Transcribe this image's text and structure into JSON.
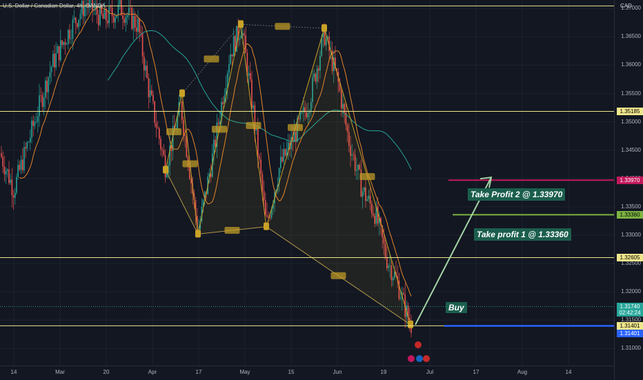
{
  "header": {
    "title": "U.S. Dollar / Canadian Dollar, 4h, OANDA"
  },
  "price_axis": {
    "currency": "CAD",
    "ticks": [
      "1.37000",
      "1.36500",
      "1.36000",
      "1.35500",
      "1.35000",
      "1.34500",
      "1.34000",
      "1.33500",
      "1.33000",
      "1.32500",
      "1.32000",
      "1.31500",
      "1.31000"
    ],
    "tick_values": [
      1.37,
      1.365,
      1.36,
      1.355,
      1.35,
      1.345,
      1.34,
      1.335,
      1.33,
      1.325,
      1.32,
      1.315,
      1.31
    ],
    "badges": [
      {
        "label": "1.35185",
        "value": 1.35185,
        "bg": "#f0e68c",
        "fg": "#000000"
      },
      {
        "label": "1.33970",
        "value": 1.3397,
        "bg": "#c2185b",
        "fg": "#ffffff"
      },
      {
        "label": "1.33360",
        "value": 1.3336,
        "bg": "#7cb342",
        "fg": "#000000"
      },
      {
        "label": "1.32605",
        "value": 1.32605,
        "bg": "#f0e68c",
        "fg": "#000000"
      },
      {
        "label": "1.31740",
        "value": 1.3174,
        "bg": "#26a69a",
        "fg": "#ffffff"
      },
      {
        "label": "02:42:24",
        "value": 1.3163,
        "bg": "#26a69a",
        "fg": "#ffffff"
      },
      {
        "label": "1.31401",
        "value": 1.31401,
        "bg": "#f0e68c",
        "fg": "#000000"
      },
      {
        "label": "1.31401",
        "value": 1.3126,
        "bg": "#2962ff",
        "fg": "#ffffff"
      }
    ]
  },
  "time_axis": {
    "labels": [
      "14",
      "Mar",
      "20",
      "Apr",
      "17",
      "May",
      "15",
      "Jun",
      "19",
      "Jul",
      "17",
      "Aug",
      "14"
    ]
  },
  "annotations": {
    "tp2": "Take Profit 2 @ 1.33970",
    "tp1": "Take profit 1 @ 1.33360",
    "buy": "Buy"
  },
  "colors": {
    "background": "#131722",
    "up": "#26a69a",
    "down": "#ef5350",
    "level_line": "#f0e68c",
    "tp2_line": "#c2185b",
    "tp1_line": "#7cb342",
    "buy_line": "#2962ff",
    "arrow": "#a5d6a7",
    "ma_fast": "#e8872b",
    "ma_slow": "#26a69a",
    "harmonic": "#c9a227"
  },
  "chart_data": {
    "type": "candlestick",
    "symbol": "U.S. Dollar / Canadian Dollar",
    "timeframe": "4h",
    "source": "OANDA",
    "x": [
      "14",
      "Mar",
      "20",
      "Apr",
      "17",
      "May",
      "15",
      "Jun",
      "19",
      "Jul",
      "17",
      "Aug",
      "14"
    ],
    "ylim": [
      1.307,
      1.3715
    ],
    "price_path": [
      {
        "x": 0,
        "y": 1.3445
      },
      {
        "x": 20,
        "y": 1.338
      },
      {
        "x": 45,
        "y": 1.348
      },
      {
        "x": 75,
        "y": 1.36
      },
      {
        "x": 100,
        "y": 1.366
      },
      {
        "x": 125,
        "y": 1.371
      },
      {
        "x": 150,
        "y": 1.368
      },
      {
        "x": 175,
        "y": 1.37
      },
      {
        "x": 200,
        "y": 1.367
      },
      {
        "x": 215,
        "y": 1.356
      },
      {
        "x": 240,
        "y": 1.342
      },
      {
        "x": 262,
        "y": 1.353
      },
      {
        "x": 287,
        "y": 1.3305
      },
      {
        "x": 310,
        "y": 1.345
      },
      {
        "x": 333,
        "y": 1.362
      },
      {
        "x": 350,
        "y": 1.367
      },
      {
        "x": 368,
        "y": 1.351
      },
      {
        "x": 386,
        "y": 1.3315
      },
      {
        "x": 405,
        "y": 1.342
      },
      {
        "x": 425,
        "y": 1.347
      },
      {
        "x": 448,
        "y": 1.3535
      },
      {
        "x": 470,
        "y": 1.3655
      },
      {
        "x": 490,
        "y": 1.357
      },
      {
        "x": 505,
        "y": 1.347
      },
      {
        "x": 525,
        "y": 1.338
      },
      {
        "x": 545,
        "y": 1.3335
      },
      {
        "x": 560,
        "y": 1.326
      },
      {
        "x": 575,
        "y": 1.322
      },
      {
        "x": 585,
        "y": 1.318
      },
      {
        "x": 595,
        "y": 1.3142
      }
    ],
    "harmonic_pattern": [
      {
        "x": 240,
        "y": 1.3415
      },
      {
        "x": 264,
        "y": 1.355
      },
      {
        "x": 287,
        "y": 1.3302
      },
      {
        "x": 349,
        "y": 1.3672
      },
      {
        "x": 386,
        "y": 1.3315
      },
      {
        "x": 470,
        "y": 1.3665
      },
      {
        "x": 595,
        "y": 1.3142
      }
    ],
    "horizontal_levels": [
      1.37045,
      1.35185,
      1.32605,
      1.31401
    ],
    "targets": [
      {
        "label": "Take Profit 2 @ 1.33970",
        "value": 1.3397
      },
      {
        "label": "Take profit 1 @ 1.33360",
        "value": 1.3336
      }
    ],
    "entry": {
      "label": "Buy",
      "value": 1.31401
    },
    "last_price": 1.3174,
    "countdown": "02:42:24"
  }
}
